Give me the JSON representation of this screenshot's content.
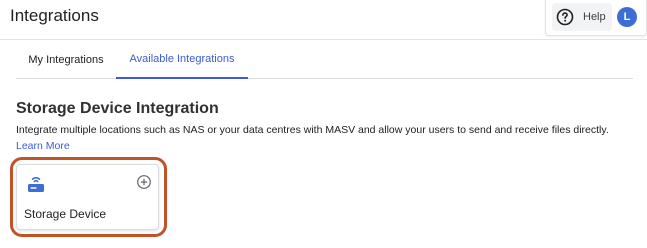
{
  "header": {
    "title": "Integrations",
    "help_label": "Help",
    "avatar_initial": "L"
  },
  "tabs": [
    {
      "label": "My Integrations",
      "active": false
    },
    {
      "label": "Available Integrations",
      "active": true
    }
  ],
  "section": {
    "title": "Storage Device Integration",
    "description": "Integrate multiple locations such as NAS or your data centres with MASV and allow your users to send and receive files directly.",
    "learn_more": "Learn More"
  },
  "cards": [
    {
      "label": "Storage Device",
      "icon": "storage-device-icon",
      "action_icon": "add-circle-icon"
    }
  ],
  "colors": {
    "accent": "#3b5bdb",
    "avatar": "#3d6ed6",
    "highlight": "#c2522a"
  }
}
